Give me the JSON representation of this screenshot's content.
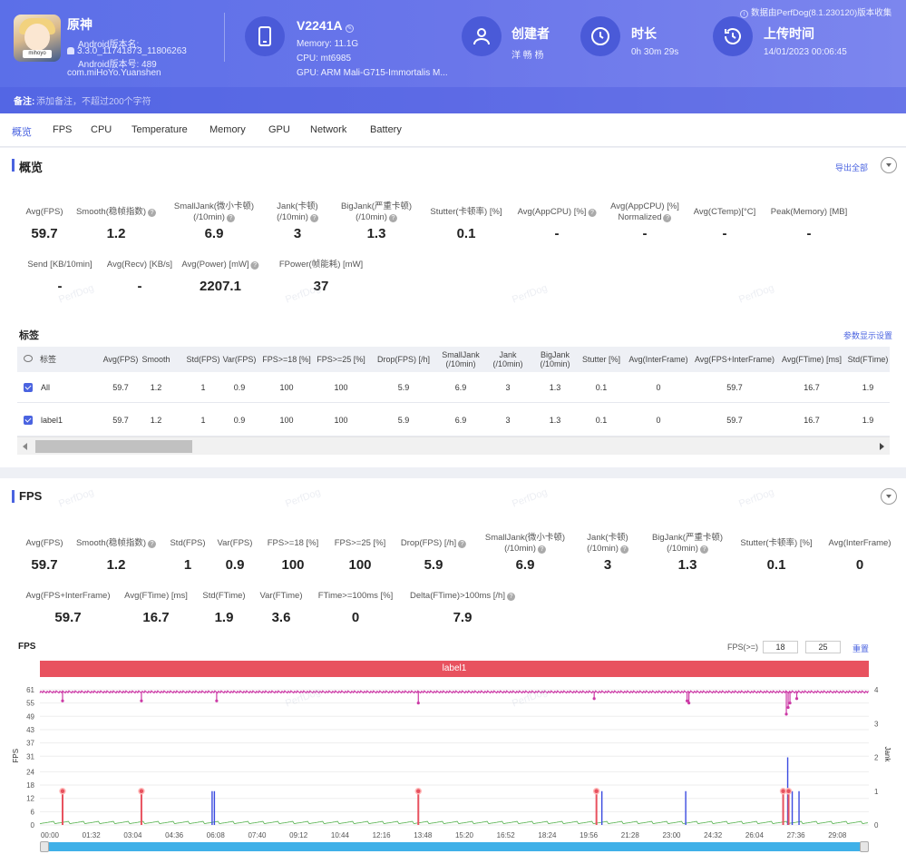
{
  "header": {
    "app_name": "原神",
    "app_icon_tag": "mihoyo",
    "version_label": "Android版本名:",
    "version_value": "3.3.0_11741873_11806263",
    "version_code": "Android版本号: 489",
    "package": "com.miHoYo.Yuanshen",
    "device_name": "V2241A",
    "memory": "Memory: 11.1G",
    "cpu": "CPU: mt6985",
    "gpu": "GPU: ARM Mali-G715-Immortalis M...",
    "creator_title": "创建者",
    "creator_value": "洋 畅 杨",
    "duration_title": "时长",
    "duration_value": "0h 30m 29s",
    "upload_title": "上传时间",
    "upload_value": "14/01/2023 00:06:45",
    "data_source": "数据由PerfDog(8.1.230120)版本收集",
    "note_label": "备注:",
    "note_placeholder": "添加备注，不超过200个字符"
  },
  "tabs": [
    "概览",
    "FPS",
    "CPU",
    "Temperature",
    "Memory",
    "GPU",
    "Network",
    "Battery"
  ],
  "overview": {
    "title": "概览",
    "export_all": "导出全部",
    "stats_row1": [
      {
        "label": "Avg(FPS)",
        "value": "59.7"
      },
      {
        "label": "Smooth(稳帧指数)",
        "value": "1.2",
        "help": true
      },
      {
        "label": "SmallJank(微小卡顿)",
        "label2": "(/10min)",
        "value": "6.9",
        "help": true
      },
      {
        "label": "Jank(卡顿)",
        "label2": "(/10min)",
        "value": "3",
        "help": true
      },
      {
        "label": "BigJank(严重卡顿)",
        "label2": "(/10min)",
        "value": "1.3",
        "help": true
      },
      {
        "label": "Stutter(卡顿率) [%]",
        "value": "0.1"
      },
      {
        "label": "Avg(AppCPU) [%]",
        "value": "-",
        "help": true
      },
      {
        "label": "Avg(AppCPU) [%]",
        "label2": "Normalized",
        "value": "-",
        "help": true
      },
      {
        "label": "Avg(CTemp)[°C]",
        "value": "-"
      },
      {
        "label": "Peak(Memory) [MB]",
        "value": "-"
      }
    ],
    "stats_row2": [
      {
        "label": "Send [KB/10min]",
        "value": "-"
      },
      {
        "label": "Avg(Recv) [KB/s]",
        "value": "-"
      },
      {
        "label": "Avg(Power) [mW]",
        "value": "2207.1",
        "help": true
      },
      {
        "label": "FPower(帧能耗) [mW]",
        "value": "37"
      }
    ],
    "labels_title": "标签",
    "param_settings": "参数显示设置",
    "table": {
      "headers": [
        "标签",
        "Avg(FPS)",
        "Smooth",
        "Std(FPS)",
        "Var(FPS)",
        "FPS>=18 [%]",
        "FPS>=25 [%]",
        "Drop(FPS) [/h]",
        "SmallJank (/10min)",
        "Jank (/10min)",
        "BigJank (/10min)",
        "Stutter [%]",
        "Avg(InterFrame)",
        "Avg(FPS+InterFrame)",
        "Avg(FTime) [ms]",
        "Std(FTime)"
      ],
      "rows": [
        [
          "All",
          "59.7",
          "1.2",
          "1",
          "0.9",
          "100",
          "100",
          "5.9",
          "6.9",
          "3",
          "1.3",
          "0.1",
          "0",
          "59.7",
          "16.7",
          "1.9"
        ],
        [
          "label1",
          "59.7",
          "1.2",
          "1",
          "0.9",
          "100",
          "100",
          "5.9",
          "6.9",
          "3",
          "1.3",
          "0.1",
          "0",
          "59.7",
          "16.7",
          "1.9"
        ]
      ]
    }
  },
  "fps": {
    "title": "FPS",
    "stats_row1": [
      {
        "label": "Avg(FPS)",
        "value": "59.7"
      },
      {
        "label": "Smooth(稳帧指数)",
        "value": "1.2",
        "help": true
      },
      {
        "label": "Std(FPS)",
        "value": "1"
      },
      {
        "label": "Var(FPS)",
        "value": "0.9"
      },
      {
        "label": "FPS>=18 [%]",
        "value": "100"
      },
      {
        "label": "FPS>=25 [%]",
        "value": "100"
      },
      {
        "label": "Drop(FPS) [/h]",
        "value": "5.9",
        "help": true
      },
      {
        "label": "SmallJank(微小卡顿)",
        "label2": "(/10min)",
        "value": "6.9",
        "help": true
      },
      {
        "label": "Jank(卡顿)",
        "label2": "(/10min)",
        "value": "3",
        "help": true
      },
      {
        "label": "BigJank(严重卡顿)",
        "label2": "(/10min)",
        "value": "1.3",
        "help": true
      },
      {
        "label": "Stutter(卡顿率) [%]",
        "value": "0.1"
      },
      {
        "label": "Avg(InterFrame)",
        "value": "0"
      }
    ],
    "stats_row2": [
      {
        "label": "Avg(FPS+InterFrame)",
        "value": "59.7"
      },
      {
        "label": "Avg(FTime) [ms]",
        "value": "16.7"
      },
      {
        "label": "Std(FTime)",
        "value": "1.9"
      },
      {
        "label": "Var(FTime)",
        "value": "3.6"
      },
      {
        "label": "FTime>=100ms [%]",
        "value": "0"
      },
      {
        "label": "Delta(FTime)>100ms [/h]",
        "value": "7.9",
        "help": true
      }
    ],
    "chart_title": "FPS",
    "threshold_label": "FPS(>=)",
    "threshold_1": "18",
    "threshold_2": "25",
    "reset": "重置",
    "label_bar": "label1",
    "watermark": "PerfDog"
  },
  "chart_data": {
    "type": "line",
    "ylabel": "FPS",
    "ylabel_right": "Jank",
    "y_ticks": [
      0,
      6,
      12,
      18,
      24,
      31,
      37,
      43,
      49,
      55,
      61
    ],
    "y_right_ticks": [
      0,
      1,
      2,
      3,
      4
    ],
    "x_ticks": [
      "00:00",
      "01:32",
      "03:04",
      "04:36",
      "06:08",
      "07:40",
      "09:12",
      "10:44",
      "12:16",
      "13:48",
      "15:20",
      "16:52",
      "18:24",
      "19:56",
      "21:28",
      "23:00",
      "24:32",
      "26:04",
      "27:36",
      "29:08"
    ],
    "xlim_seconds": [
      0,
      1829
    ],
    "fps_level": 60,
    "fps_dips": [
      [
        50,
        56
      ],
      [
        224,
        56
      ],
      [
        390,
        56
      ],
      [
        835,
        55
      ],
      [
        1223,
        57
      ],
      [
        1428,
        56
      ],
      [
        1432,
        55
      ],
      [
        1647,
        50
      ],
      [
        1651,
        53
      ],
      [
        1655,
        55
      ],
      [
        1670,
        57
      ]
    ],
    "big_jank_seconds": [
      50,
      224,
      835,
      1228,
      1640,
      1652
    ],
    "jank_spikes": [
      [
        380,
        1
      ],
      [
        385,
        1
      ],
      [
        1240,
        1
      ],
      [
        1425,
        1
      ],
      [
        1640,
        1
      ],
      [
        1650,
        2
      ],
      [
        1660,
        1
      ],
      [
        1675,
        1
      ]
    ],
    "colors": {
      "fps": "#cc3aa6",
      "jank": "#3b4be0",
      "big_jank": "#e8525f",
      "ftime": "#52b04a",
      "accent": "#4a63e0",
      "label_bar": "#e8525f",
      "slider": "#3fb0e8"
    }
  }
}
